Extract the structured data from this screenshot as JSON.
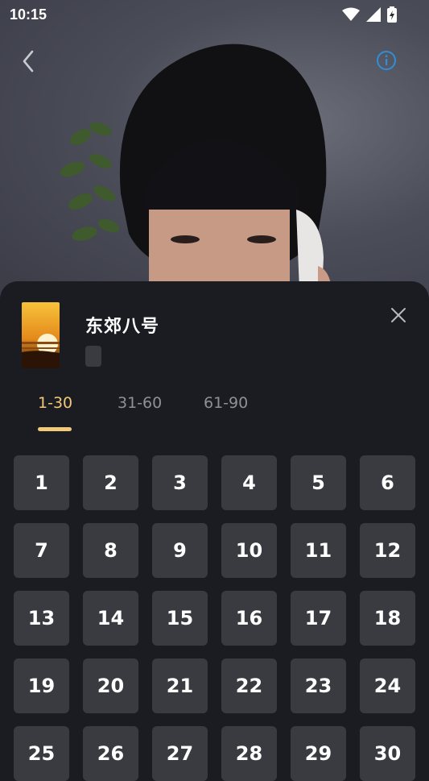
{
  "status_bar": {
    "time": "10:15",
    "icons": [
      "wifi-icon",
      "cell-signal-icon",
      "battery-charging-icon"
    ]
  },
  "player": {
    "back_icon": "chevron-left-icon",
    "info_icon": "info-circle-icon",
    "info_color": "#2f8fd8"
  },
  "sheet": {
    "title": "东郊八号",
    "close_icon": "close-icon",
    "tabs": [
      {
        "label": "1-30",
        "active": true
      },
      {
        "label": "31-60",
        "active": false
      },
      {
        "label": "61-90",
        "active": false
      }
    ],
    "accent_color": "#f2c879",
    "episodes": [
      "1",
      "2",
      "3",
      "4",
      "5",
      "6",
      "7",
      "8",
      "9",
      "10",
      "11",
      "12",
      "13",
      "14",
      "15",
      "16",
      "17",
      "18",
      "19",
      "20",
      "21",
      "22",
      "23",
      "24",
      "25",
      "26",
      "27",
      "28",
      "29",
      "30"
    ]
  }
}
